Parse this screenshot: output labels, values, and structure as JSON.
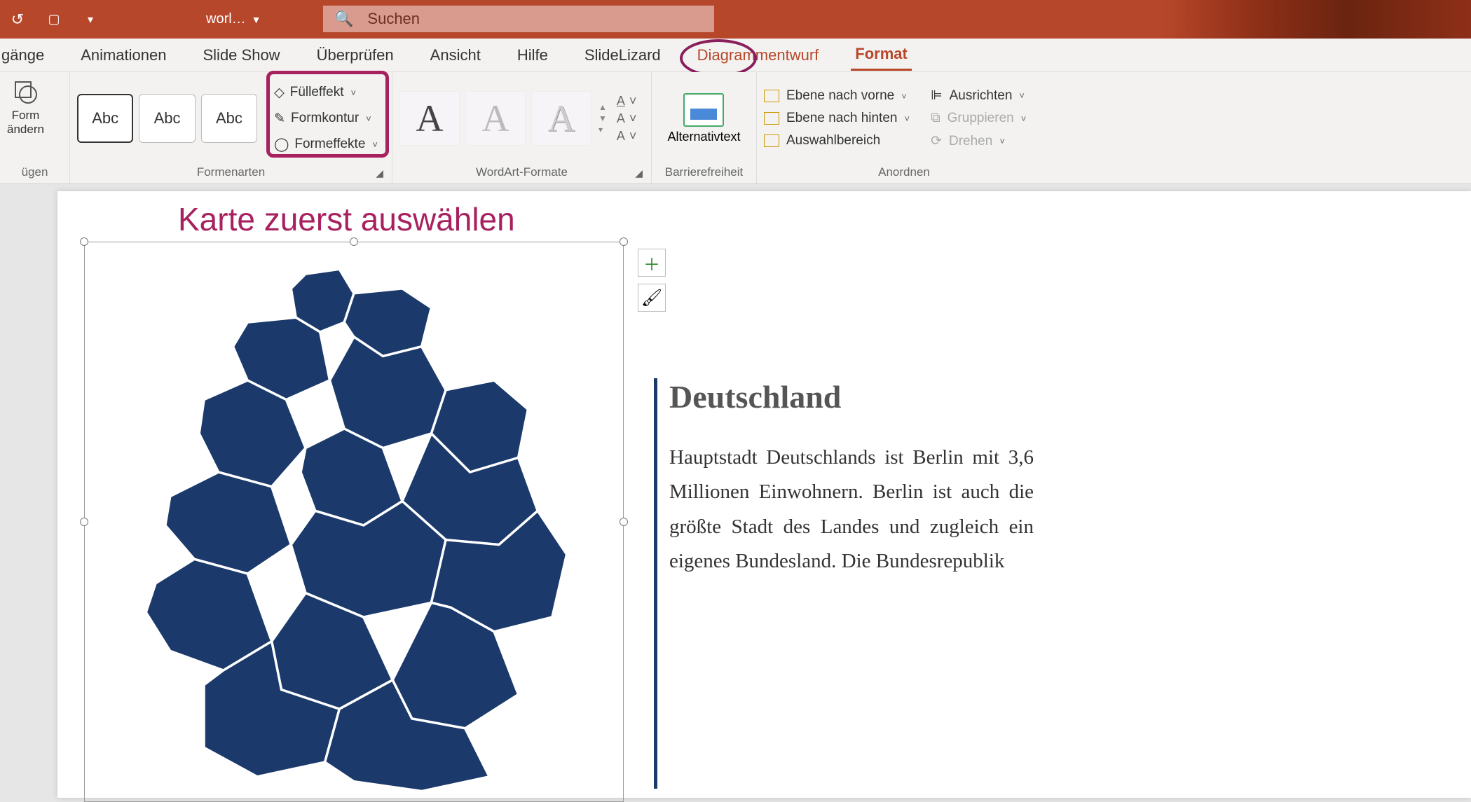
{
  "titlebar": {
    "doc_name": "worl…",
    "search_placeholder": "Suchen"
  },
  "tabs": {
    "uebergaenge": "gänge",
    "animationen": "Animationen",
    "slideshow": "Slide Show",
    "ueberpruefen": "Überprüfen",
    "ansicht": "Ansicht",
    "hilfe": "Hilfe",
    "slidelizard": "SlideLizard",
    "diagrammentwurf": "Diagrammentwurf",
    "format": "Format"
  },
  "ribbon": {
    "form_aendern": "Form\nändern",
    "einfuegen_label": "ügen",
    "abc": "Abc",
    "fuelleffekt": "Fülleffekt",
    "formkontur": "Formkontur",
    "formeffekte": "Formeffekte",
    "formenarten": "Formenarten",
    "wordart_formate": "WordArt-Formate",
    "alternativtext": "Alternativtext",
    "barrierefreiheit": "Barrierefreiheit",
    "ebene_vorne": "Ebene nach vorne",
    "ebene_hinten": "Ebene nach hinten",
    "auswahlbereich": "Auswahlbereich",
    "ausrichten": "Ausrichten",
    "gruppieren": "Gruppieren",
    "drehen": "Drehen",
    "anordnen": "Anordnen"
  },
  "slide": {
    "annotation": "Karte zuerst auswählen",
    "heading": "Deutschland",
    "body": "Hauptstadt Deutschlands ist Berlin mit 3,6 Millionen Einwohnern. Berlin ist auch die größte Stadt des Landes und zugleich ein eigenes Bundesland. Die Bundesrepublik"
  }
}
